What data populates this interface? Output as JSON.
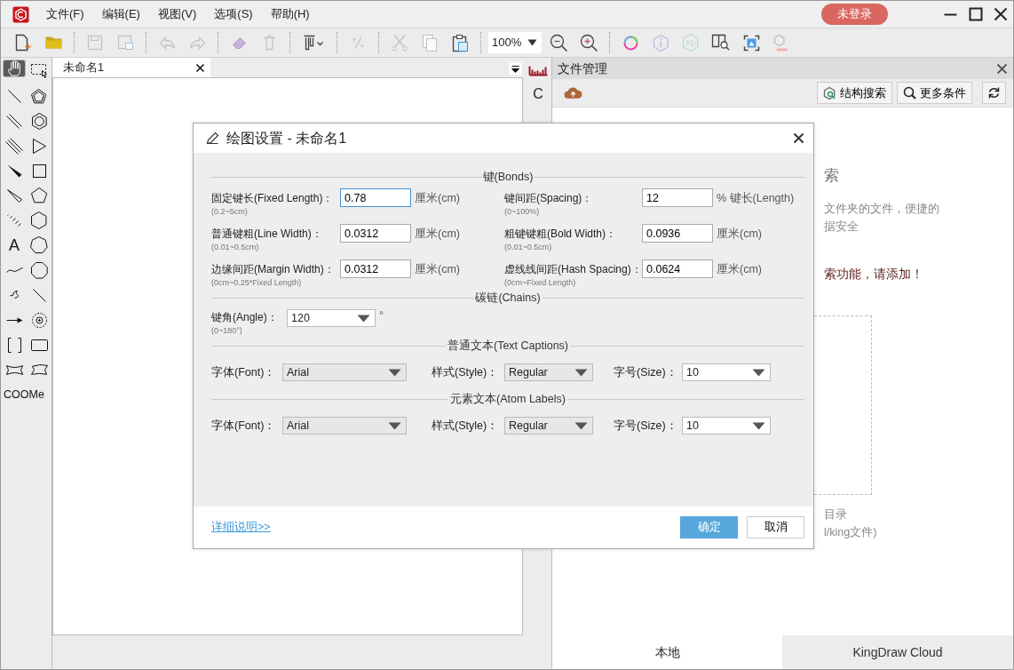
{
  "window": {
    "menus": [
      "文件(F)",
      "编辑(E)",
      "视图(V)",
      "选项(S)",
      "帮助(H)"
    ],
    "login_button": "未登录"
  },
  "toolbar": {
    "items": [
      {
        "kind": "new",
        "disabled": false
      },
      {
        "kind": "open",
        "disabled": false
      },
      {
        "kind": "sep"
      },
      {
        "kind": "save",
        "disabled": true
      },
      {
        "kind": "saveas",
        "disabled": true
      },
      {
        "kind": "sep"
      },
      {
        "kind": "undo",
        "disabled": true
      },
      {
        "kind": "redo",
        "disabled": true
      },
      {
        "kind": "sep"
      },
      {
        "kind": "eraser",
        "disabled": false
      },
      {
        "kind": "trash",
        "disabled": true
      },
      {
        "kind": "sep"
      },
      {
        "kind": "align",
        "disabled": false
      },
      {
        "kind": "sep"
      },
      {
        "kind": "percent",
        "disabled": true
      },
      {
        "kind": "sep"
      },
      {
        "kind": "cut",
        "disabled": true
      },
      {
        "kind": "copy",
        "disabled": true
      },
      {
        "kind": "paste",
        "disabled": false
      },
      {
        "kind": "sep"
      },
      {
        "kind": "zoom"
      },
      {
        "kind": "zoomout",
        "disabled": false
      },
      {
        "kind": "zoomin",
        "disabled": false
      },
      {
        "kind": "sep"
      },
      {
        "kind": "ring",
        "disabled": false
      },
      {
        "kind": "info",
        "disabled": true
      },
      {
        "kind": "threed",
        "disabled": true
      },
      {
        "kind": "booksearch",
        "disabled": false
      },
      {
        "kind": "imagescan",
        "disabled": false
      },
      {
        "kind": "name",
        "disabled": true
      }
    ],
    "zoom": "100%"
  },
  "tools": [
    {
      "kind": "hand",
      "selected": true
    },
    {
      "kind": "marquee",
      "selected": false
    },
    {
      "kind": "line",
      "selected": false
    },
    {
      "kind": "pentagon-inner",
      "selected": false
    },
    {
      "kind": "double-line",
      "selected": false
    },
    {
      "kind": "hexagon-inner",
      "selected": false
    },
    {
      "kind": "triple-line",
      "selected": false
    },
    {
      "kind": "triangle",
      "selected": false
    },
    {
      "kind": "wedge",
      "selected": false
    },
    {
      "kind": "square",
      "selected": false
    },
    {
      "kind": "hollow-wedge",
      "selected": false
    },
    {
      "kind": "pentagon",
      "selected": false
    },
    {
      "kind": "hash-wedge",
      "selected": false
    },
    {
      "kind": "hexagon",
      "selected": false
    },
    {
      "kind": "text",
      "label": "A",
      "selected": false
    },
    {
      "kind": "heptagon",
      "selected": false
    },
    {
      "kind": "chain",
      "selected": false
    },
    {
      "kind": "octagon",
      "selected": false
    },
    {
      "kind": "wavy",
      "selected": false
    },
    {
      "kind": "bold-line",
      "selected": false
    },
    {
      "kind": "arrow",
      "selected": false
    },
    {
      "kind": "charge",
      "selected": false
    },
    {
      "kind": "brackets",
      "selected": false
    },
    {
      "kind": "rectangle",
      "selected": false
    },
    {
      "kind": "banner",
      "selected": false
    },
    {
      "kind": "banner2",
      "selected": false
    },
    {
      "kind": "text",
      "label": "COOMe",
      "selected": false
    }
  ],
  "document_tab": {
    "title": "未命名1"
  },
  "side_strip": {
    "label": "C"
  },
  "file_panel": {
    "title": "文件管理",
    "buttons": [
      "结构搜索",
      "更多条件"
    ],
    "fragments": [
      {
        "kind": "heading",
        "text": "索"
      },
      {
        "kind": "muted",
        "text": "文件夹的文件，便捷的"
      },
      {
        "kind": "muted",
        "text": "据安全"
      },
      {
        "kind": "notice",
        "text": "索功能，请添加！"
      },
      {
        "kind": "dropzone"
      },
      {
        "kind": "muted",
        "text": "目录"
      },
      {
        "kind": "muted",
        "text": "l/king文件)"
      }
    ],
    "tabs": [
      {
        "label": "本地",
        "selected": true
      },
      {
        "label": "KingDraw Cloud",
        "selected": false
      }
    ]
  },
  "dialog": {
    "title": "绘图设置 - 未命名1",
    "sections": [
      {
        "title": "键(Bonds)",
        "kind": "pairs",
        "fields": [
          {
            "label": "固定键长(Fixed Length)：",
            "hint": "(0.2~5cm)",
            "value": "0.78",
            "unit": "厘米(cm)",
            "focused": true
          },
          {
            "label": "键间距(Spacing)：",
            "hint": "(0~100%)",
            "value": "12",
            "unit": "% 键长(Length)",
            "focused": false
          },
          {
            "label": "普通键粗(Line Width)：",
            "hint": "(0.01~0.5cm)",
            "value": "0.0312",
            "unit": "厘米(cm)",
            "focused": false
          },
          {
            "label": "粗键键粗(Bold Width)：",
            "hint": "(0.01~0.5cm)",
            "value": "0.0936",
            "unit": "厘米(cm)",
            "focused": false
          },
          {
            "label": "边缘间距(Margin Width)：",
            "hint": "(0cm~0.25*Fixed Length)",
            "value": "0.0312",
            "unit": "厘米(cm)",
            "focused": false
          },
          {
            "label": "虚线线间距(Hash Spacing)：",
            "hint": "(0cm~Fixed Length)",
            "value": "0.0624",
            "unit": "厘米(cm)",
            "focused": false
          }
        ]
      },
      {
        "title": "碳链(Chains)",
        "kind": "angle",
        "fields": [
          {
            "label": "键角(Angle)：",
            "hint": "(0~180°)",
            "value": "120",
            "unit": "°"
          }
        ]
      },
      {
        "title": "普通文本(Text Captions)",
        "kind": "fonts",
        "fields": [
          {
            "label": "字体(Font)：",
            "value": "Arial"
          },
          {
            "label": "样式(Style)：",
            "value": "Regular"
          },
          {
            "label": "字号(Size)：",
            "value": "10"
          }
        ]
      },
      {
        "title": "元素文本(Atom Labels)",
        "kind": "fonts",
        "fields": [
          {
            "label": "字体(Font)：",
            "value": "Arial"
          },
          {
            "label": "样式(Style)：",
            "value": "Regular"
          },
          {
            "label": "字号(Size)：",
            "value": "10"
          }
        ]
      }
    ],
    "link": "详细说明>>",
    "ok": "确定",
    "cancel": "取消"
  }
}
